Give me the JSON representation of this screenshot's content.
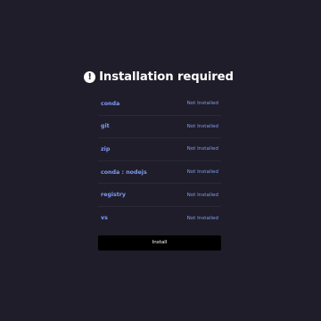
{
  "header": {
    "icon": "alert-circle-icon",
    "title": "Installation required"
  },
  "requirements": [
    {
      "name": "conda",
      "status": "Not Installed"
    },
    {
      "name": "git",
      "status": "Not Installed"
    },
    {
      "name": "zip",
      "status": "Not Installed"
    },
    {
      "name": "conda : nodejs",
      "status": "Not Installed"
    },
    {
      "name": "registry",
      "status": "Not Installed"
    },
    {
      "name": "vs",
      "status": "Not Installed"
    }
  ],
  "actions": {
    "install_label": "Install"
  },
  "colors": {
    "background": "#1f1d29",
    "accent": "#7f9bf2",
    "button": "#000000"
  }
}
